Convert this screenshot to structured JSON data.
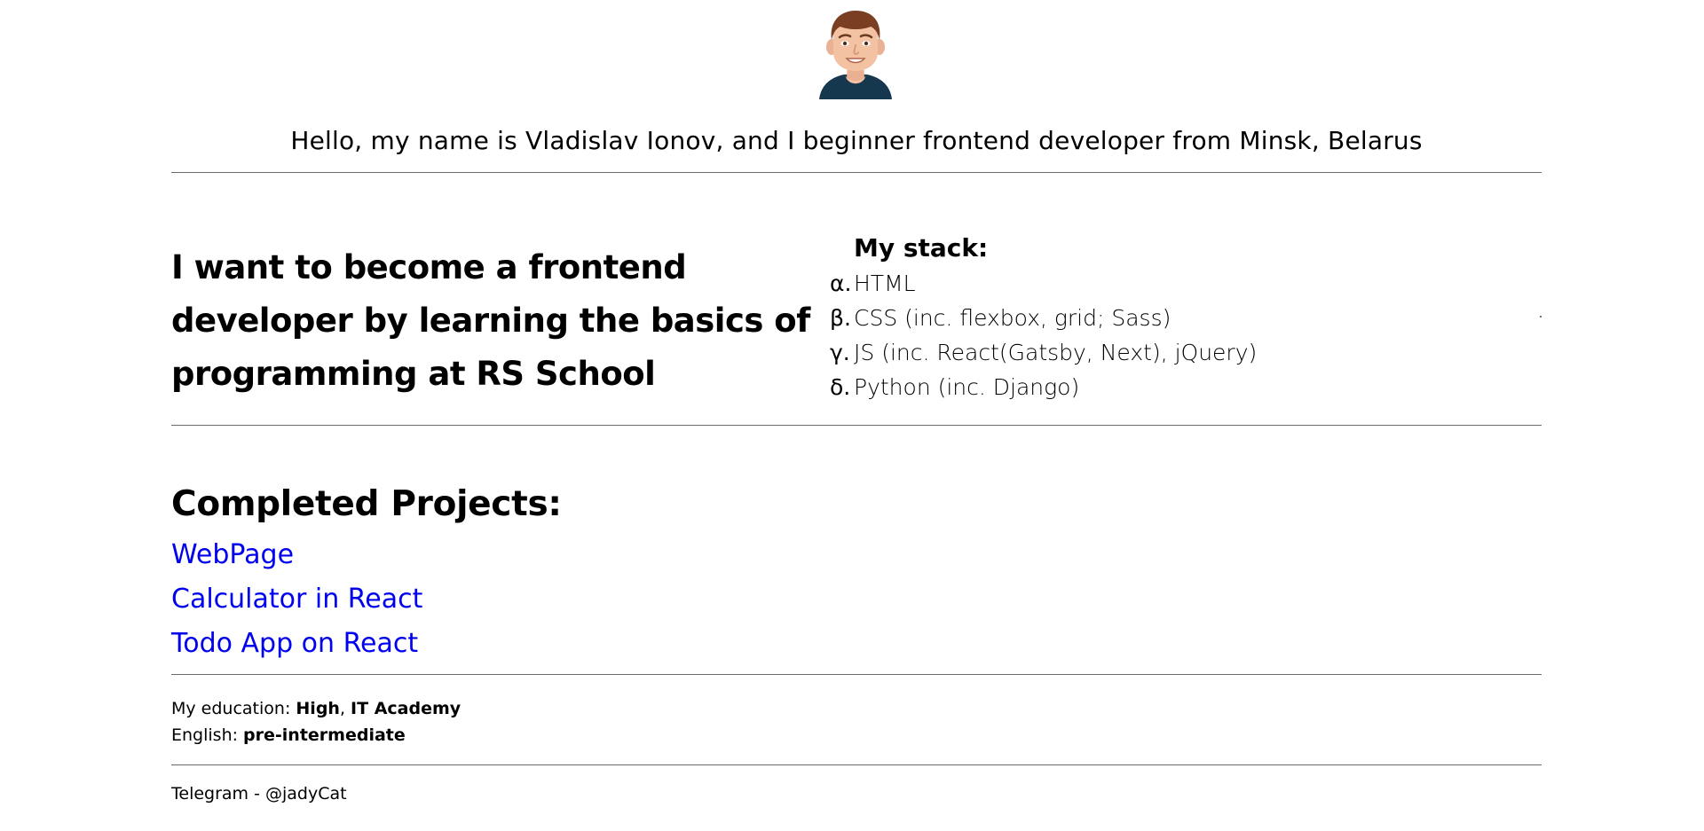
{
  "avatar": {
    "alt": "Developer avatar"
  },
  "intro": {
    "text": "Hello, my name is Vladislav Ionov, and I beginner frontend developer from Minsk, Belarus"
  },
  "goal": {
    "text": "I want to become a frontend developer by learning the basics of programming at RS School"
  },
  "stack": {
    "title": "My stack:",
    "items": [
      {
        "marker": "α.",
        "label": "HTML"
      },
      {
        "marker": "β.",
        "label": "CSS (inc. flexbox, grid; Sass)"
      },
      {
        "marker": "γ.",
        "label": "JS (inc. React(Gatsby, Next), jQuery)"
      },
      {
        "marker": "δ.",
        "label": "Python (inc. Django)"
      }
    ]
  },
  "projects": {
    "title": "Completed Projects:",
    "items": [
      {
        "label": "WebPage"
      },
      {
        "label": "Calculator in React"
      },
      {
        "label": "Todo App on React"
      }
    ],
    "link_color": "#0000ee"
  },
  "education": {
    "label": "My education: ",
    "level": "High",
    "separator": ", ",
    "school": "IT Academy",
    "english_label": "English: ",
    "english_level": "pre-intermediate"
  },
  "contact": {
    "text": "Telegram - @jadyCat"
  },
  "colors": {
    "divider": "#6b6b6b",
    "avatar_shirt": "#16384f",
    "avatar_hair": "#7a3f22",
    "avatar_skin": "#f3c2a3"
  }
}
